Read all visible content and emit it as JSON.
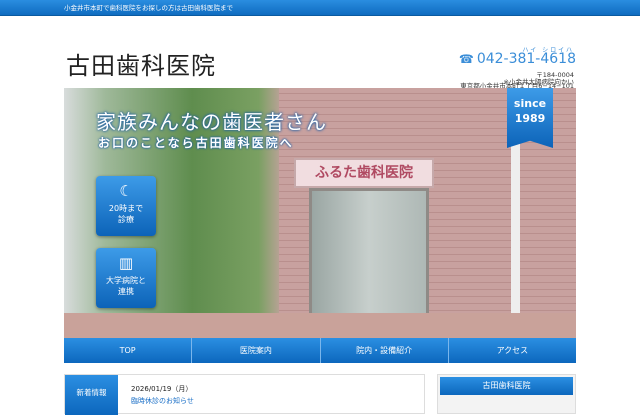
{
  "topbar": {
    "text": "小金井市本町で歯科医院をお探しの方は古田歯科医院まで"
  },
  "header": {
    "logo": "古田歯科医院",
    "phone_kana": "ハイ シロイハ",
    "phone": "042-381-4618",
    "postal": "〒184-0004",
    "address": "東京都小金井市本町１丁目6−14−101",
    "landmark": "※小金井太陽病院向かい"
  },
  "hero": {
    "headline": "家族みんなの歯医者さん",
    "subheadline": "お口のことなら古田歯科医院へ",
    "sign": "ふるた歯科医院",
    "since": "since",
    "since_year": "1989",
    "badges": [
      {
        "icon": "moon-icon",
        "label1": "20時まで",
        "label2": "診療"
      },
      {
        "icon": "hospital-icon",
        "label1": "大学病院と",
        "label2": "連携"
      }
    ]
  },
  "nav": {
    "items": [
      "TOP",
      "医院案内",
      "院内・設備紹介",
      "アクセス"
    ]
  },
  "news": {
    "label": "新着情報",
    "date": "2026/01/19（月）",
    "link": "臨時休診のお知らせ"
  },
  "sidebar": {
    "title": "古田歯科医院"
  }
}
